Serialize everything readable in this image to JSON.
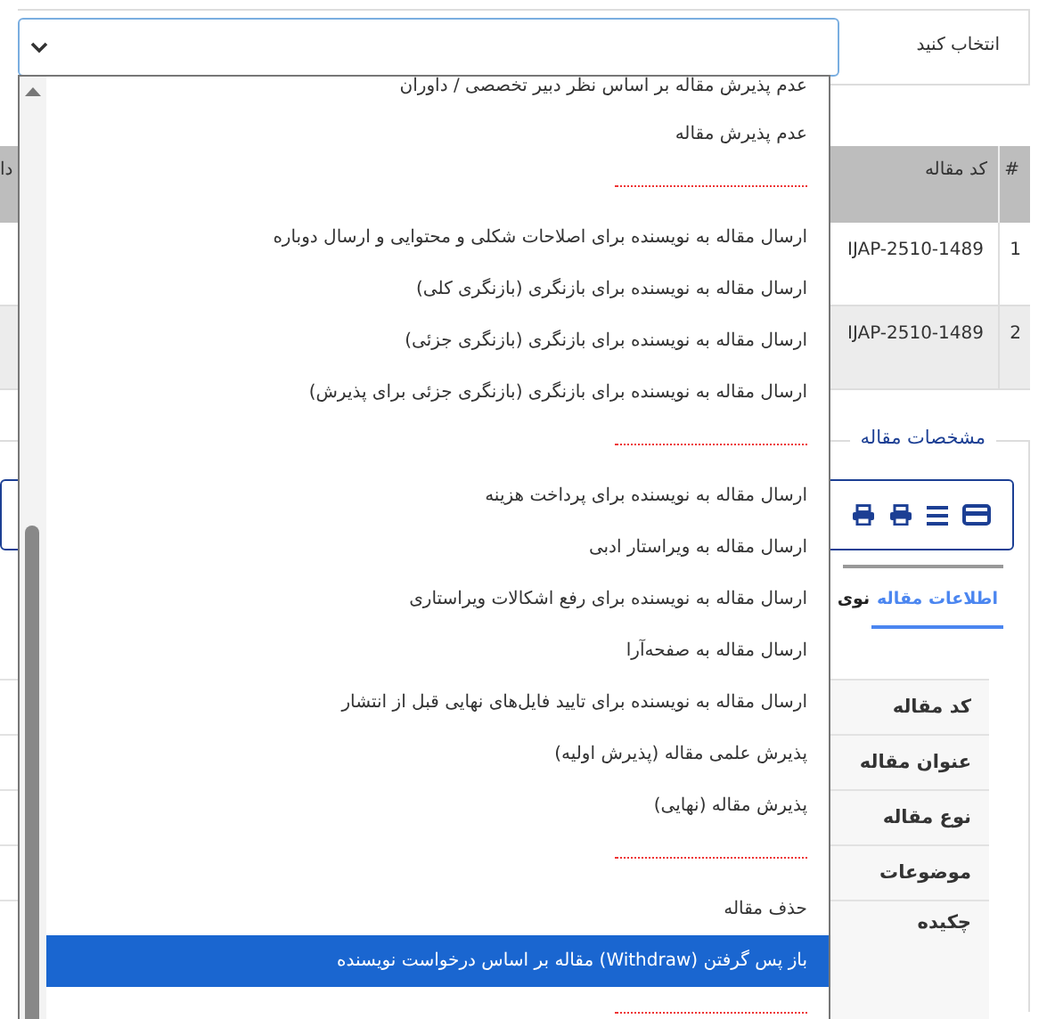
{
  "selector": {
    "label": "انتخاب کنید",
    "options": [
      {
        "kind": "option",
        "text": "عدم پذیرش مقاله بر اساس نظر دبیر تخصصی / داوران",
        "selected": false
      },
      {
        "kind": "option",
        "text": "عدم پذیرش مقاله",
        "selected": false
      },
      {
        "kind": "separator"
      },
      {
        "kind": "option",
        "text": "ارسال مقاله به نویسنده برای اصلاحات شکلی و محتوایی و ارسال دوباره",
        "selected": false
      },
      {
        "kind": "option",
        "text": "ارسال مقاله به نویسنده برای بازنگری (بازنگری کلی)",
        "selected": false
      },
      {
        "kind": "option",
        "text": "ارسال مقاله به نویسنده برای بازنگری (بازنگری جزئی)",
        "selected": false
      },
      {
        "kind": "option",
        "text": "ارسال مقاله به نویسنده برای بازنگری (بازنگری جزئی برای پذیرش)",
        "selected": false
      },
      {
        "kind": "separator"
      },
      {
        "kind": "option",
        "text": "ارسال مقاله به نویسنده برای پرداخت هزینه",
        "selected": false
      },
      {
        "kind": "option",
        "text": "ارسال مقاله به ویراستار ادبی",
        "selected": false
      },
      {
        "kind": "option",
        "text": "ارسال مقاله به نویسنده برای رفع اشکالات ویراستاری",
        "selected": false
      },
      {
        "kind": "option",
        "text": "ارسال مقاله به صفحه‌آرا",
        "selected": false
      },
      {
        "kind": "option",
        "text": "ارسال مقاله به نویسنده برای تایید فایل‌های نهایی قبل از انتشار",
        "selected": false
      },
      {
        "kind": "option",
        "text": "پذیرش علمی مقاله (پذیرش اولیه)",
        "selected": false
      },
      {
        "kind": "option",
        "text": "پذیرش مقاله (نهایی)",
        "selected": false
      },
      {
        "kind": "separator"
      },
      {
        "kind": "option",
        "text": "حذف مقاله",
        "selected": false
      },
      {
        "kind": "option",
        "text": "باز پس گرفتن (Withdraw) مقاله بر اساس درخواست نویسنده",
        "selected": true
      },
      {
        "kind": "separator"
      }
    ]
  },
  "table": {
    "columns": [
      "#",
      "کد مقاله",
      "دا"
    ],
    "rows": [
      {
        "cells": [
          "1",
          "IJAP-2510-1489"
        ]
      },
      {
        "cells": [
          "2",
          "IJAP-2510-1489"
        ]
      }
    ]
  },
  "details": {
    "legend": "مشخصات مقاله",
    "tabs": [
      {
        "label": "اطلاعات مقاله",
        "selected": true
      },
      {
        "label": "نوی",
        "selected": false
      }
    ],
    "fields": [
      "کد مقاله",
      "عنوان مقاله",
      "نوع مقاله",
      "موضوعات",
      "چکیده"
    ]
  }
}
